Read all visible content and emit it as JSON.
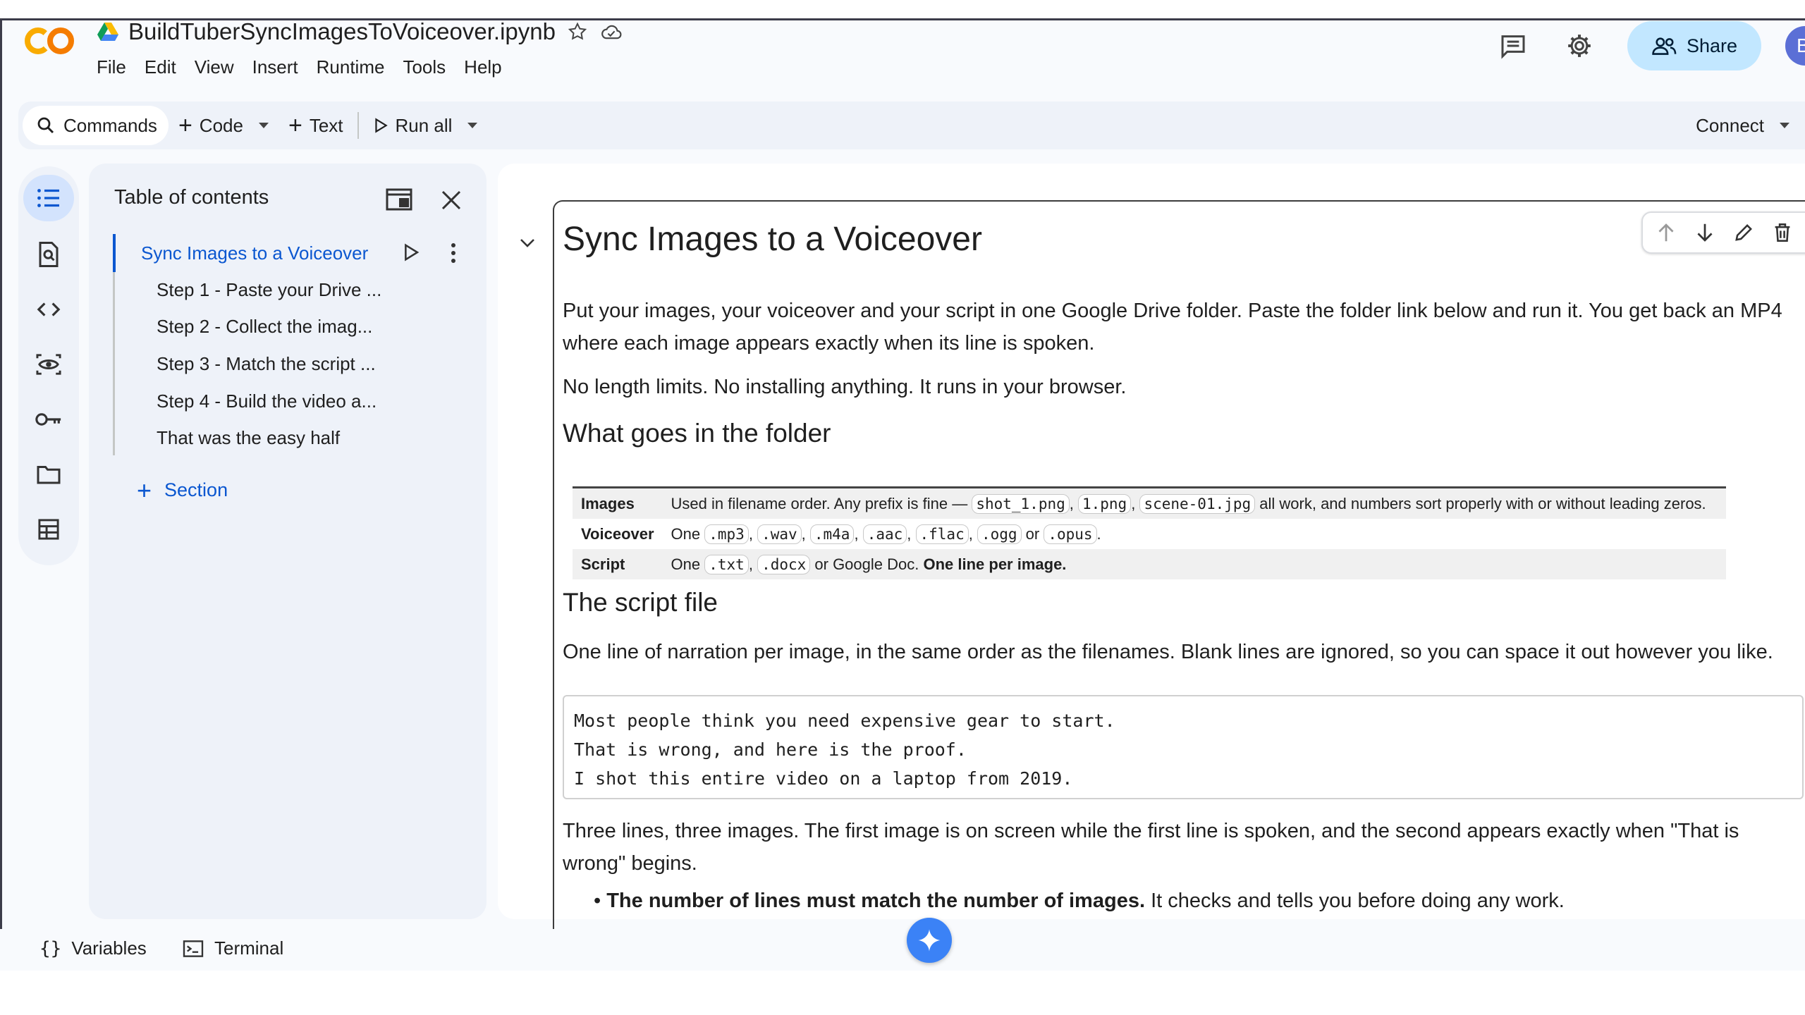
{
  "app": {
    "notebook_title": "BuildTuberSyncImagesToVoiceover.ipynb",
    "menu": [
      "File",
      "Edit",
      "View",
      "Insert",
      "Runtime",
      "Tools",
      "Help"
    ],
    "share_label": "Share",
    "avatar_letter": "B"
  },
  "toolbar": {
    "commands_label": "Commands",
    "code_label": "Code",
    "text_label": "Text",
    "run_all_label": "Run all",
    "connect_label": "Connect"
  },
  "toc": {
    "title": "Table of contents",
    "items": [
      {
        "label": "Sync Images to a Voiceover",
        "level": 1,
        "active": true
      },
      {
        "label": "Step 1 - Paste your Drive ...",
        "level": 2
      },
      {
        "label": "Step 2 - Collect the imag...",
        "level": 2
      },
      {
        "label": "Step 3 - Match the script ...",
        "level": 2
      },
      {
        "label": "Step 4 - Build the video a...",
        "level": 2
      },
      {
        "label": "That was the easy half",
        "level": 2
      }
    ],
    "add_section_label": "Section"
  },
  "cell": {
    "h1": "Sync Images to a Voiceover",
    "intro_1a": "Put your images, your voiceover and your script in one Google Drive folder. Paste the folder link below and run it. You get back an MP4",
    "intro_1b": "where each image appears exactly when its line is spoken.",
    "intro_2": "No length limits. No installing anything. It runs in your browser.",
    "h2_folder": "What goes in the folder",
    "table": {
      "images_key": "Images",
      "images_pre": "Used in filename order. Any prefix is fine — ",
      "images_codes": [
        "shot_1.png",
        "1.png",
        "scene-01.jpg"
      ],
      "images_post": " all work, and numbers sort properly with or without leading zeros.",
      "voiceover_key": "Voiceover",
      "voiceover_pre": "One ",
      "voiceover_codes": [
        ".mp3",
        ".wav",
        ".m4a",
        ".aac",
        ".flac",
        ".ogg",
        ".opus"
      ],
      "voiceover_or": " or ",
      "script_key": "Script",
      "script_pre": "One ",
      "script_codes": [
        ".txt",
        ".docx"
      ],
      "script_mid": " or Google Doc. ",
      "script_bold": "One line per image."
    },
    "h2_script": "The script file",
    "script_desc": "One line of narration per image, in the same order as the filenames. Blank lines are ignored, so you can space it out however you like.",
    "code_lines": [
      "Most people think you need expensive gear to start.",
      "That is wrong, and here is the proof.",
      "I shot this entire video on a laptop from 2019."
    ],
    "explain_a": "Three lines, three images. The first image is on screen while the first line is spoken, and the second appears exactly when \"That is",
    "explain_b": "wrong\" begins.",
    "bullet_bold": "The number of lines must match the number of images.",
    "bullet_rest": " It checks and tells you before doing any work."
  },
  "bottom": {
    "variables_label": "Variables",
    "terminal_label": "Terminal"
  },
  "colors": {
    "accent_blue": "#0b57d0",
    "share_bg": "#c2e7ff",
    "panel_bg": "#eef2f9"
  }
}
